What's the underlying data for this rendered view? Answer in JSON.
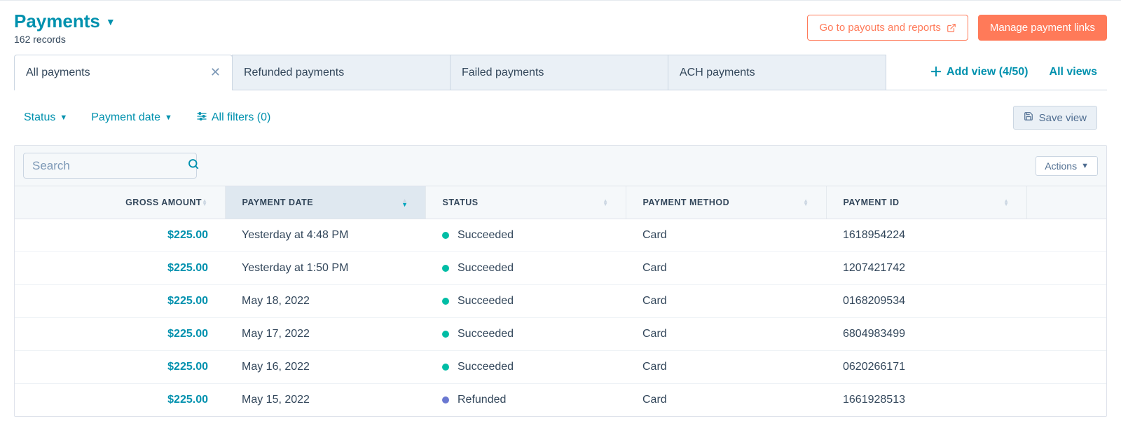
{
  "header": {
    "title": "Payments",
    "records": "162 records",
    "payouts_label": "Go to payouts and reports",
    "manage_label": "Manage payment links"
  },
  "tabs": {
    "items": [
      {
        "label": "All payments"
      },
      {
        "label": "Refunded payments"
      },
      {
        "label": "Failed payments"
      },
      {
        "label": "ACH payments"
      }
    ],
    "add_view": "Add view (4/50)",
    "all_views": "All views"
  },
  "filters": {
    "status": "Status",
    "payment_date": "Payment date",
    "all_filters": "All filters (0)",
    "save_view": "Save view"
  },
  "toolbar": {
    "search_placeholder": "Search",
    "actions": "Actions"
  },
  "columns": {
    "gross_amount": "GROSS AMOUNT",
    "payment_date": "PAYMENT DATE",
    "status": "STATUS",
    "payment_method": "PAYMENT METHOD",
    "payment_id": "PAYMENT ID"
  },
  "rows": [
    {
      "amount": "$225.00",
      "date": "Yesterday at 4:48 PM",
      "status": "Succeeded",
      "status_kind": "succeeded",
      "method": "Card",
      "id": "1618954224"
    },
    {
      "amount": "$225.00",
      "date": "Yesterday at 1:50 PM",
      "status": "Succeeded",
      "status_kind": "succeeded",
      "method": "Card",
      "id": "1207421742"
    },
    {
      "amount": "$225.00",
      "date": "May 18, 2022",
      "status": "Succeeded",
      "status_kind": "succeeded",
      "method": "Card",
      "id": "0168209534"
    },
    {
      "amount": "$225.00",
      "date": "May 17, 2022",
      "status": "Succeeded",
      "status_kind": "succeeded",
      "method": "Card",
      "id": "6804983499"
    },
    {
      "amount": "$225.00",
      "date": "May 16, 2022",
      "status": "Succeeded",
      "status_kind": "succeeded",
      "method": "Card",
      "id": "0620266171"
    },
    {
      "amount": "$225.00",
      "date": "May 15, 2022",
      "status": "Refunded",
      "status_kind": "refunded",
      "method": "Card",
      "id": "1661928513"
    }
  ]
}
